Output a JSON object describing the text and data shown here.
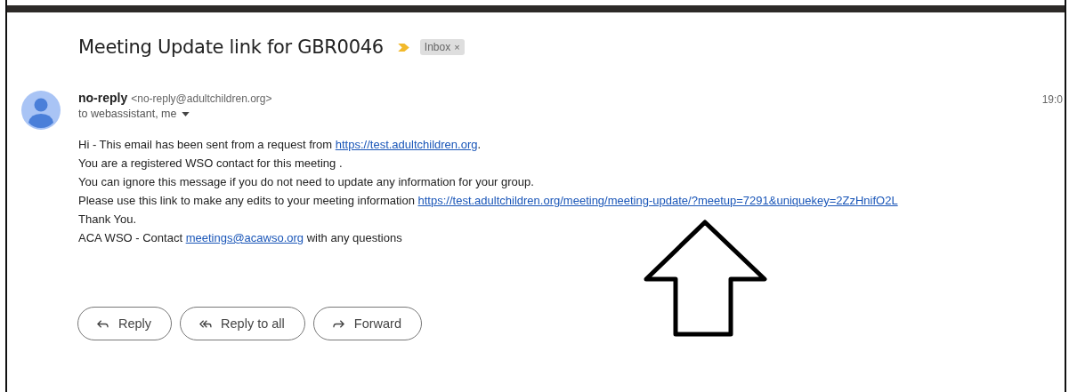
{
  "subject": "Meeting Update link for GBR0046",
  "important": true,
  "label": {
    "text": "Inbox",
    "close": "×"
  },
  "sender": {
    "name": "no-reply",
    "email": "<no-reply@adultchildren.org>",
    "recipients": "to webassistant, me",
    "time": "19:0"
  },
  "body": [
    [
      {
        "kind": "text",
        "text": "Hi - This email has been sent from a request from "
      },
      {
        "kind": "link",
        "text": "https://test.adultchildren.org"
      },
      {
        "kind": "text",
        "text": "."
      }
    ],
    [
      {
        "kind": "text",
        "text": "You are a registered WSO contact for this meeting ."
      }
    ],
    [
      {
        "kind": "text",
        "text": "You can ignore this message if you do not need to update any information for your group."
      }
    ],
    [
      {
        "kind": "text",
        "text": "Please use this link to make any edits to your meeting information "
      },
      {
        "kind": "link",
        "text": "https://test.adultchildren.org/meeting/meeting-update/?meetup=7291&uniquekey=2ZzHnifO2L"
      }
    ],
    [
      {
        "kind": "text",
        "text": "Thank You."
      }
    ],
    [
      {
        "kind": "text",
        "text": "ACA WSO - Contact "
      },
      {
        "kind": "link",
        "text": "meetings@acawso.org"
      },
      {
        "kind": "text",
        "text": " with any questions"
      }
    ]
  ],
  "actions": [
    {
      "kind": "reply",
      "label": "Reply"
    },
    {
      "kind": "reply_all",
      "label": "Reply to all"
    },
    {
      "kind": "forward",
      "label": "Forward"
    }
  ]
}
